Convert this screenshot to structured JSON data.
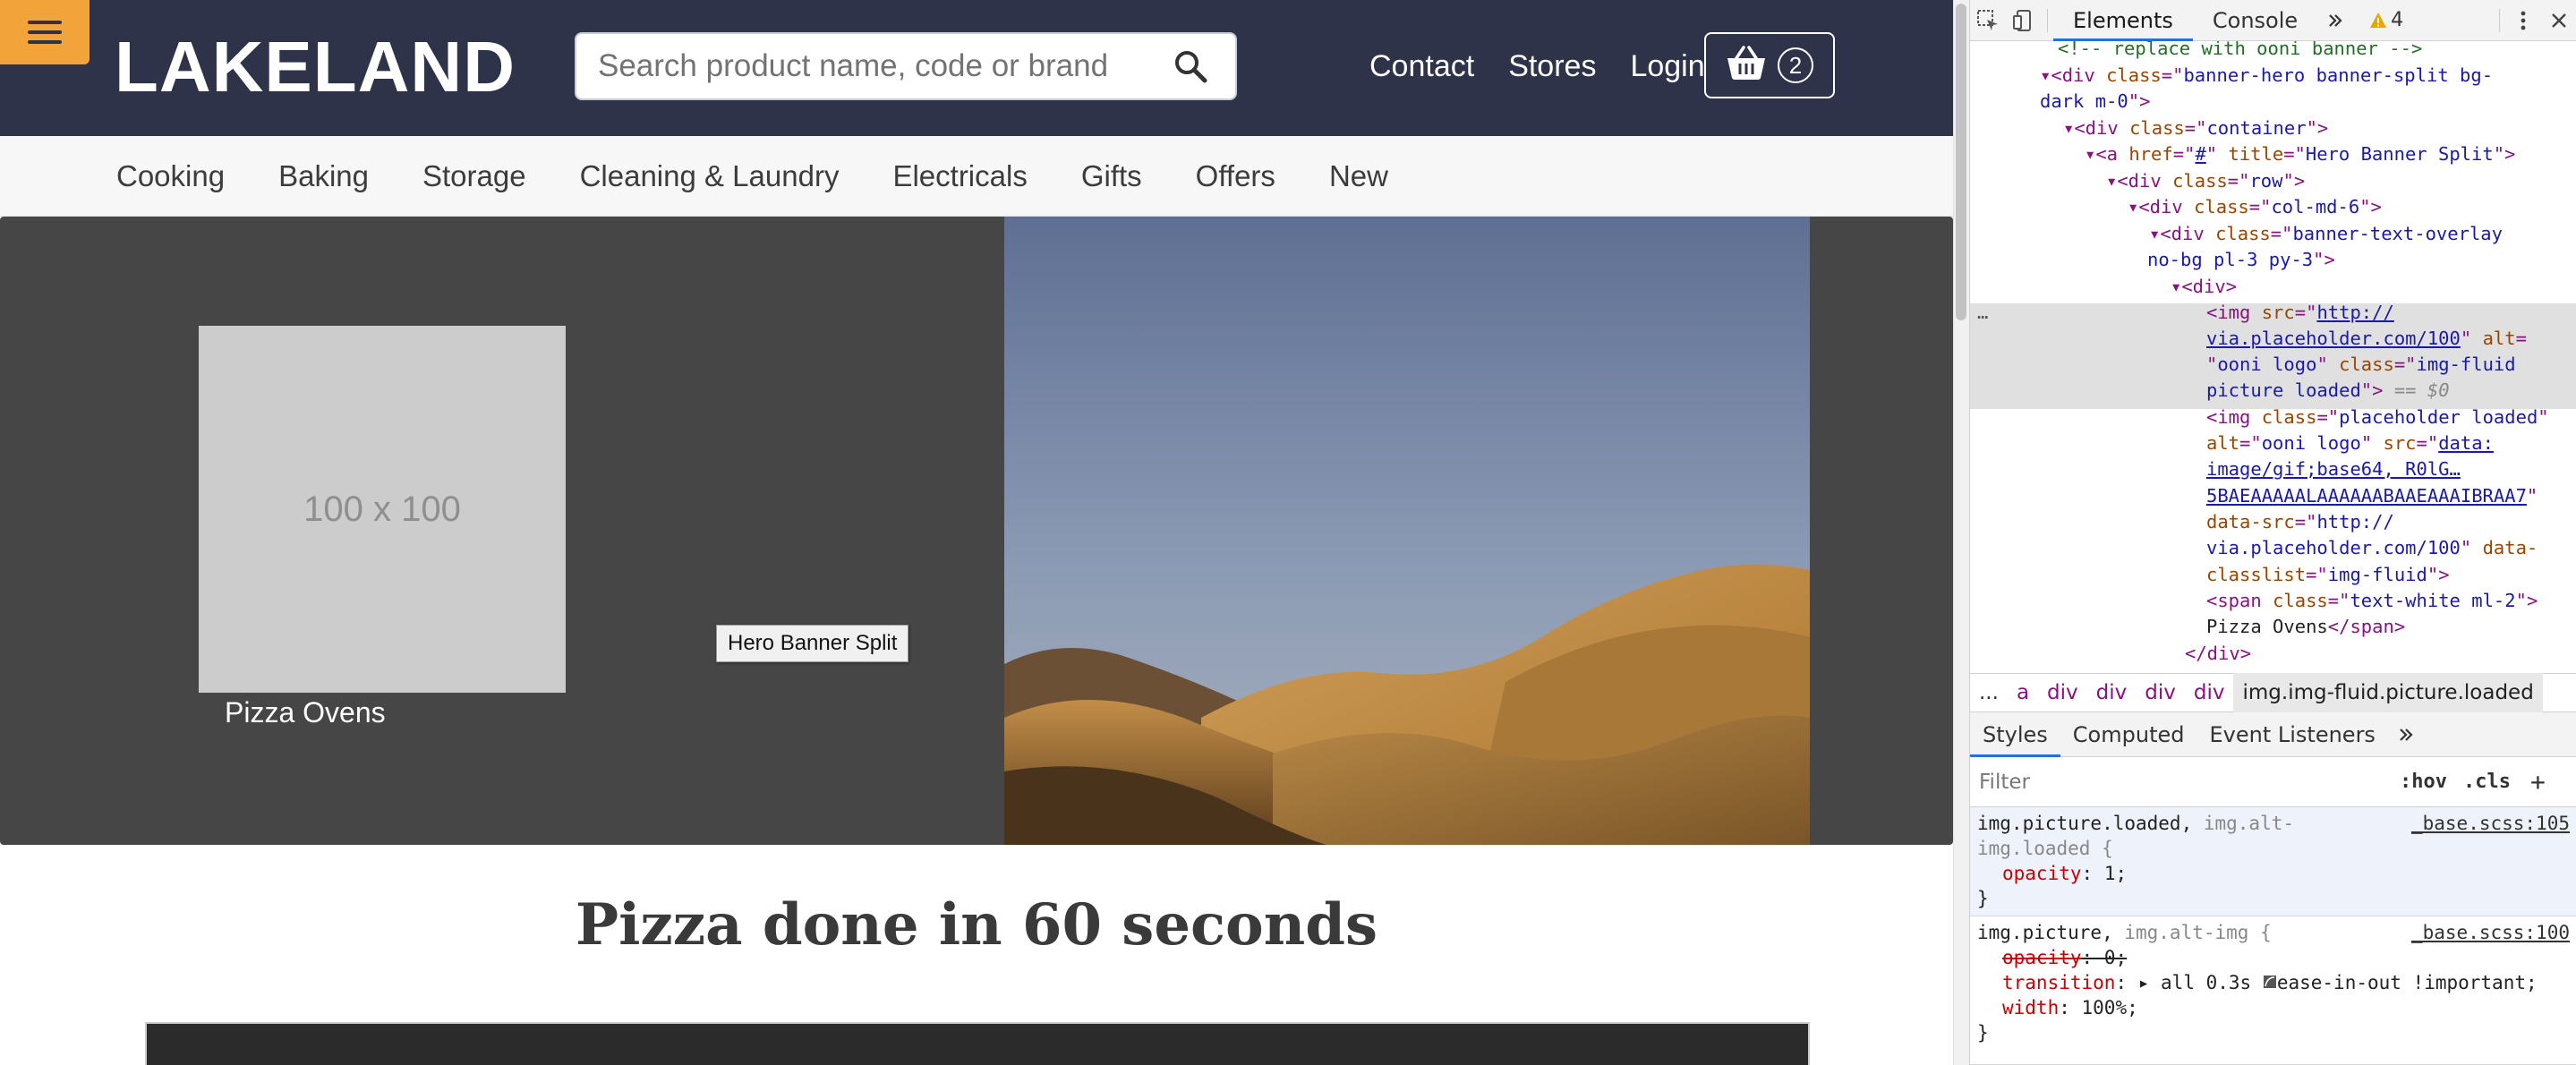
{
  "site": {
    "logo": "LAKELAND",
    "search": {
      "placeholder": "Search product name, code or brand"
    },
    "top_links": [
      "Contact",
      "Stores",
      "Login"
    ],
    "basket_count": "2",
    "categories": [
      "Cooking",
      "Baking",
      "Storage",
      "Cleaning & Laundry",
      "Electricals",
      "Gifts",
      "Offers",
      "New"
    ],
    "hero": {
      "placeholder_text": "100 x 100",
      "caption": "Pizza Ovens",
      "tooltip": "Hero Banner Split"
    },
    "headline": "Pizza done in 60 seconds",
    "colors": {
      "header": "#2e3349",
      "menu_button": "#f2a33a",
      "hero_bg": "#464646"
    }
  },
  "devtools": {
    "tabs": [
      "Elements",
      "Console"
    ],
    "active_tab": "Elements",
    "warning_count": "4",
    "dom": {
      "comment": "<!-- replace with ooni banner -->",
      "l1_tag": "div",
      "l1_class": "banner-hero banner-split bg-",
      "l1_class_cont": "dark m-0",
      "l2_class": "container",
      "l3_href": "#",
      "l3_title": "Hero Banner Split",
      "l4_class": "row",
      "l5_class": "col-md-6",
      "l6_class": "banner-text-overlay",
      "l6_class_cont": "no-bg pl-3 py-3",
      "img1_src_a": "http://",
      "img1_src_b": "via.placeholder.com/100",
      "img1_alt": "ooni logo",
      "img1_class": "img-fluid",
      "img1_class_cont": "picture loaded",
      "img1_eq": "== $0",
      "img2_class": "placeholder loaded",
      "img2_alt": "ooni logo",
      "img2_src_a": "data:",
      "img2_src_b": "image/gif;base64, R0lG…",
      "img2_src_c": "5BAEAAAAALAAAAAABAAEAAAIBRAA7",
      "img2_datasrc_a": "http://",
      "img2_datasrc_b": "via.placeholder.com/100",
      "img2_dataclass": "img-fluid",
      "span_class": "text-white ml-2",
      "span_text": "Pizza Ovens",
      "close_div": "</div>"
    },
    "breadcrumb": [
      "...",
      "a",
      "div",
      "div",
      "div",
      "div",
      "img.img-fluid.picture.loaded"
    ],
    "styles_tabs": [
      "Styles",
      "Computed",
      "Event Listeners"
    ],
    "filter_placeholder": "Filter",
    "filter_buttons": [
      ":hov",
      ".cls",
      "+"
    ],
    "rules": [
      {
        "selector": "img.picture.loaded,",
        "selector_dim": " img.alt-",
        "selector_dim2": "img.loaded {",
        "source": "_base.scss:105",
        "prop": "opacity",
        "value": "1;"
      },
      {
        "selector": "img.picture,",
        "selector_dim": " img.alt-img {",
        "source": "_base.scss:100",
        "p1": "opacity",
        "v1": "0;",
        "p2": "transition",
        "v2": "all 0.3s",
        "v2b": "ease-in-out !important;",
        "p3": "width",
        "v3": "100%;"
      }
    ]
  }
}
